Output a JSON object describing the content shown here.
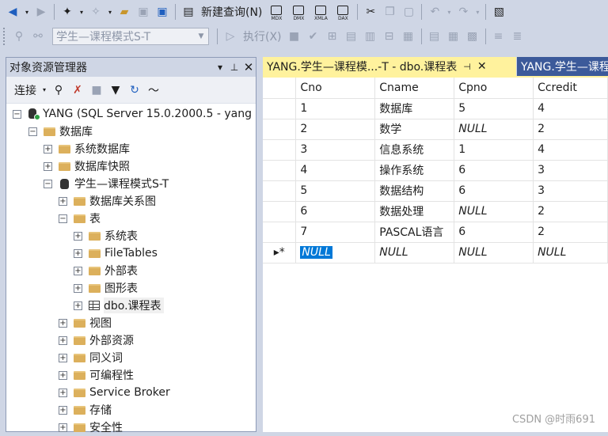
{
  "toolbar1": {
    "new_query_label": "新建查询(N)",
    "mini_docs": [
      "MDX",
      "DMX",
      "XMLA",
      "DAX"
    ]
  },
  "toolbar2": {
    "database_select": "学生—课程模式S-T",
    "execute_label": "执行(X)"
  },
  "object_explorer": {
    "title": "对象资源管理器",
    "connect_label": "连接",
    "tree": [
      {
        "label": "YANG (SQL Server 15.0.2000.5 - yang",
        "expander": "−",
        "icon": "server-icon"
      },
      {
        "label": "数据库",
        "expander": "−",
        "icon": "folder-icon"
      },
      {
        "label": "系统数据库",
        "expander": "+",
        "icon": "folder-icon"
      },
      {
        "label": "数据库快照",
        "expander": "+",
        "icon": "folder-icon"
      },
      {
        "label": "学生—课程模式S-T",
        "expander": "−",
        "icon": "database-icon"
      },
      {
        "label": "数据库关系图",
        "expander": "+",
        "icon": "folder-icon"
      },
      {
        "label": "表",
        "expander": "−",
        "icon": "folder-icon"
      },
      {
        "label": "系统表",
        "expander": "+",
        "icon": "folder-icon"
      },
      {
        "label": "FileTables",
        "expander": "+",
        "icon": "folder-icon"
      },
      {
        "label": "外部表",
        "expander": "+",
        "icon": "folder-icon"
      },
      {
        "label": "图形表",
        "expander": "+",
        "icon": "folder-icon"
      },
      {
        "label": "dbo.课程表",
        "expander": "+",
        "icon": "table-icon"
      },
      {
        "label": "视图",
        "expander": "+",
        "icon": "folder-icon"
      },
      {
        "label": "外部资源",
        "expander": "+",
        "icon": "folder-icon"
      },
      {
        "label": "同义词",
        "expander": "+",
        "icon": "folder-icon"
      },
      {
        "label": "可编程性",
        "expander": "+",
        "icon": "folder-icon"
      },
      {
        "label": "Service Broker",
        "expander": "+",
        "icon": "folder-icon"
      },
      {
        "label": "存储",
        "expander": "+",
        "icon": "folder-icon"
      },
      {
        "label": "安全性",
        "expander": "+",
        "icon": "folder-icon"
      }
    ]
  },
  "tabs": {
    "active": "YANG.学生—课程模...-T - dbo.课程表",
    "inactive": "YANG.学生—课程"
  },
  "grid": {
    "columns": [
      "Cno",
      "Cname",
      "Cpno",
      "Ccredit"
    ],
    "rows": [
      [
        "1",
        "数据库",
        "5",
        "4"
      ],
      [
        "2",
        "数学",
        "NULL",
        "2"
      ],
      [
        "3",
        "信息系统",
        "1",
        "4"
      ],
      [
        "4",
        "操作系统",
        "6",
        "3"
      ],
      [
        "5",
        "数据结构",
        "6",
        "3"
      ],
      [
        "6",
        "数据处理",
        "NULL",
        "2"
      ],
      [
        "7",
        "PASCAL语言",
        "6",
        "2"
      ]
    ],
    "new_row": [
      "NULL",
      "NULL",
      "NULL",
      "NULL"
    ],
    "new_row_marker": "▸*"
  },
  "watermark": "CSDN @时雨691"
}
